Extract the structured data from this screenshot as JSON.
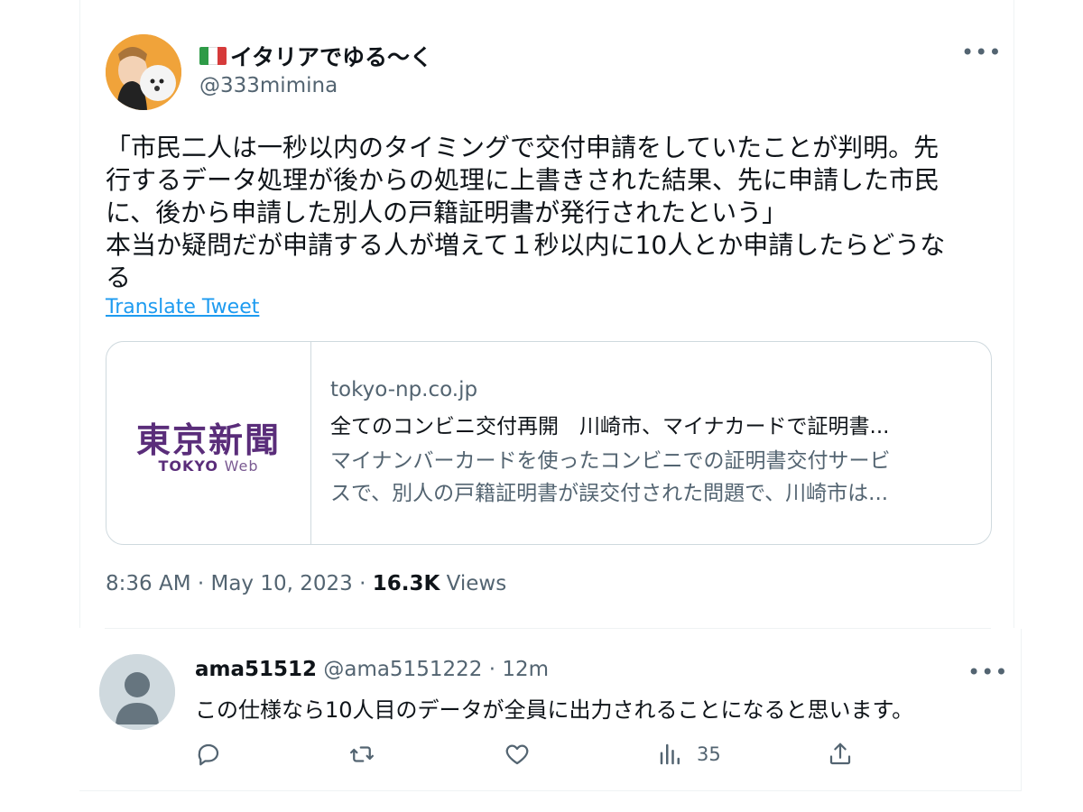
{
  "tweet": {
    "display_name": "イタリアでゆる〜く",
    "handle": "@333mimina",
    "text_lines": [
      "「市民二人は一秒以内のタイミングで交付申請をしていたことが判明。先",
      "行するデータ処理が後からの処理に上書きされた結果、先に申請した市民",
      "に、後から申請した別人の戸籍証明書が発行されたという」",
      "本当か疑問だが申請する人が増えて１秒以内に10人とか申請したらどうな",
      "る"
    ],
    "translate_label": "Translate Tweet",
    "card": {
      "logo_text": "東京新聞",
      "logo_sub_main": "TOKYO",
      "logo_sub_web": "Web",
      "domain": "tokyo-np.co.jp",
      "title": "全てのコンビニ交付再開　川崎市、マイナカードで証明書...",
      "desc_lines": [
        "マイナンバーカードを使ったコンビニでの証明書交付サービ",
        "スで、別人の戸籍証明書が誤交付された問題で、川崎市は..."
      ]
    },
    "time": "8:36 AM",
    "date": "May 10, 2023",
    "views_count": "16.3K",
    "views_label": "Views",
    "sep": "·",
    "more_icon": "•••"
  },
  "reply": {
    "name": "ama51512",
    "handle": "@ama5151222",
    "sep": "·",
    "time": "12m",
    "text": "この仕様なら10人目のデータが全員に出力されることになると思います。",
    "more_icon": "•••",
    "views_count": "35"
  },
  "colors": {
    "accent": "#1d9bf0",
    "secondary_text": "#536471",
    "border": "#cfd9de",
    "brand_purple": "#5a2d7a"
  }
}
